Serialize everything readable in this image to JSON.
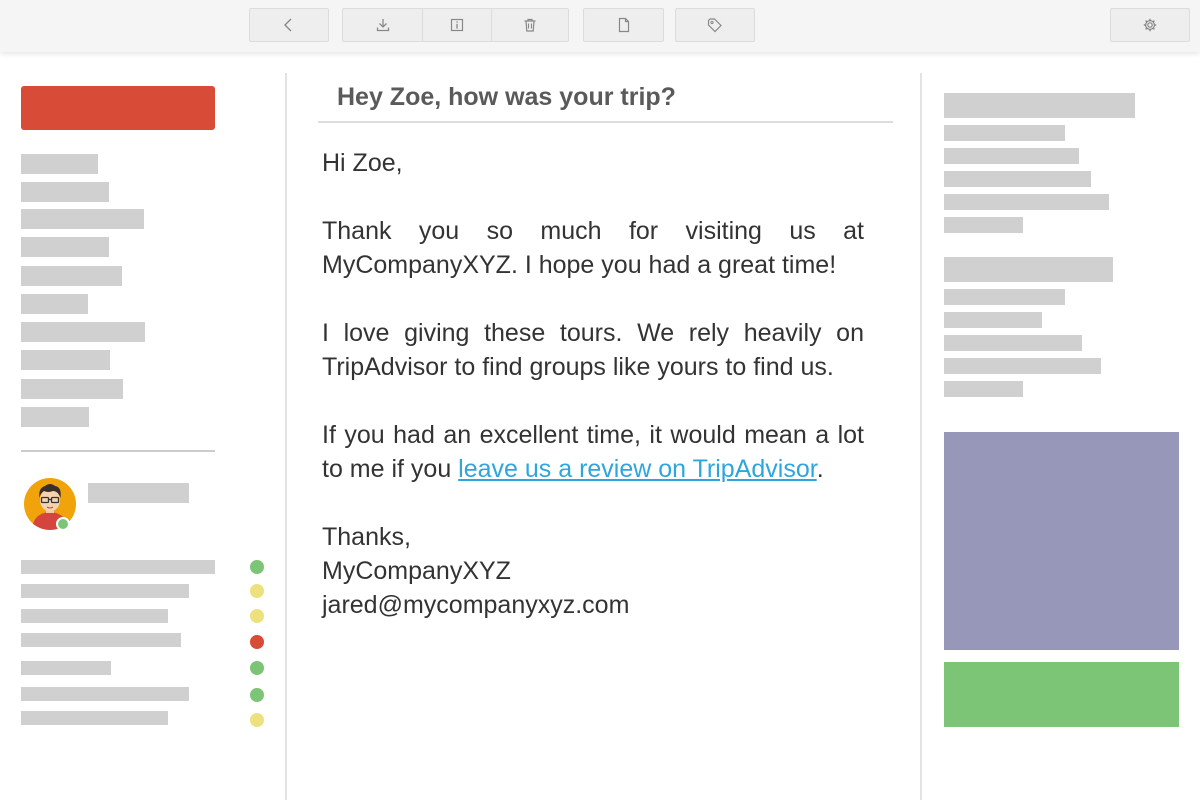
{
  "colors": {
    "compose": "#d84b37",
    "placeholder": "#d0d0d0",
    "link": "#2ea6dd",
    "status_green": "#7cc576",
    "status_yellow": "#ede17d",
    "status_red": "#d84b37",
    "ad_purple": "#9797b9",
    "ad_green": "#7cc576"
  },
  "toolbar": {
    "icons": [
      "back-icon",
      "download-icon",
      "info-icon",
      "trash-icon",
      "document-icon",
      "tag-icon",
      "gear-icon"
    ]
  },
  "contacts": {
    "statuses": [
      "green",
      "yellow",
      "yellow",
      "red",
      "green",
      "green",
      "yellow"
    ]
  },
  "email": {
    "subject": "Hey Zoe, how was your trip?",
    "greeting": "Hi Zoe,",
    "paragraph1": "Thank you so much for visiting us at MyCompanyXYZ. I hope you had a great time!",
    "paragraph2": "I love giving these tours. We rely heavily on TripAdvisor to find groups like yours to find us.",
    "paragraph3_before": "If you had an excellent time, it would mean a lot to me if you ",
    "paragraph3_link": "leave us a review on TripAdvisor",
    "paragraph3_after": ".",
    "signoff": "Thanks,",
    "signature_name": "MyCompanyXYZ",
    "signature_email": "jared@mycompanyxyz.com"
  }
}
